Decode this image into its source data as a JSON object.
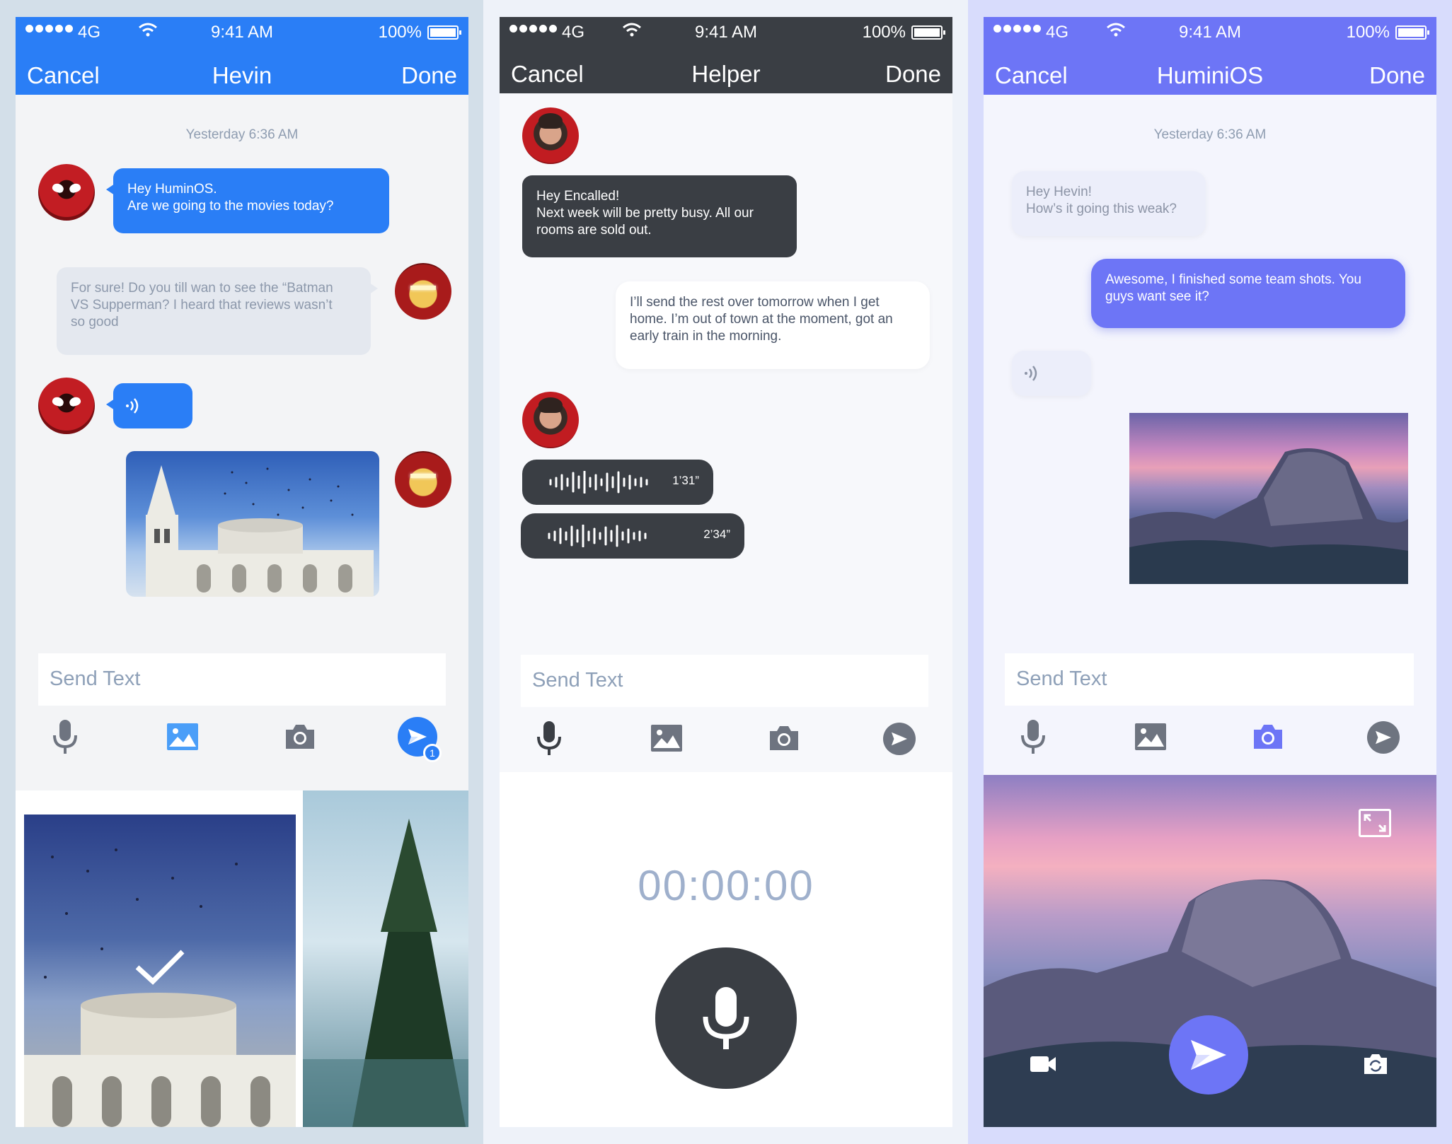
{
  "status": {
    "network": "4G",
    "time": "9:41 AM",
    "battery": "100%"
  },
  "screen1": {
    "nav": {
      "left": "Cancel",
      "title": "Hevin",
      "right": "Done"
    },
    "timestamp": "Yesterday 6:36 AM",
    "msg1": [
      "Hey HuminOS.",
      "Are we going to the movies today?"
    ],
    "msg2": [
      "For sure! Do you till wan to see the “Batman",
      "VS Supperman? I heard that reviews wasn’t",
      "so good"
    ],
    "input_placeholder": "Send Text",
    "send_badge": "1"
  },
  "screen2": {
    "nav": {
      "left": "Cancel",
      "title": "Helper",
      "right": "Done"
    },
    "msg1": [
      "Hey Encalled!",
      "Next week will be pretty busy. All our",
      "rooms are sold out."
    ],
    "msg2": [
      "I’ll send the rest over tomorrow when I get",
      "home. I’m out of town at the moment, got an",
      "early train in the morning."
    ],
    "voice1": "1’31”",
    "voice2": "2’34”",
    "input_placeholder": "Send Text",
    "timer": "00:00:00"
  },
  "screen3": {
    "nav": {
      "left": "Cancel",
      "title": "HuminiOS",
      "right": "Done"
    },
    "timestamp": "Yesterday 6:36 AM",
    "msg1": [
      "Hey Hevin!",
      "How’s it going this weak?"
    ],
    "msg2": [
      "Awesome, I finished some team shots. You",
      "guys want see it?"
    ],
    "input_placeholder": "Send Text"
  },
  "colors": {
    "blue": "#2a7ef6",
    "dark": "#3a3e44",
    "purple": "#6d75f6",
    "icon_grey": "#6e7480"
  }
}
